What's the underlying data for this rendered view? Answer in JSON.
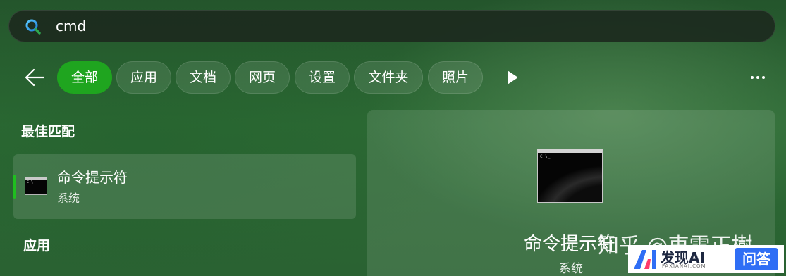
{
  "search": {
    "value": "cmd"
  },
  "filters": [
    {
      "label": "全部",
      "active": true
    },
    {
      "label": "应用"
    },
    {
      "label": "文档"
    },
    {
      "label": "网页"
    },
    {
      "label": "设置"
    },
    {
      "label": "文件夹"
    },
    {
      "label": "照片"
    }
  ],
  "sections": {
    "best_match": "最佳匹配",
    "apps": "应用"
  },
  "best_match_item": {
    "title": "命令提示符",
    "subtitle": "系统"
  },
  "preview": {
    "title": "命令提示符",
    "subtitle": "系统",
    "icon": "cmd-icon"
  },
  "watermark": {
    "text": "知乎 @東雷正樹"
  },
  "badge": {
    "name": "发现AI",
    "url": "FAXIANAI.COM",
    "qa": "问答"
  },
  "colors": {
    "accent": "#1fa51f",
    "search_bg": "#1c2a1e",
    "badge_blue": "#2f6ef5"
  },
  "icons": [
    "search-icon",
    "back-arrow-icon",
    "play-icon",
    "more-icon",
    "cmd-icon"
  ]
}
